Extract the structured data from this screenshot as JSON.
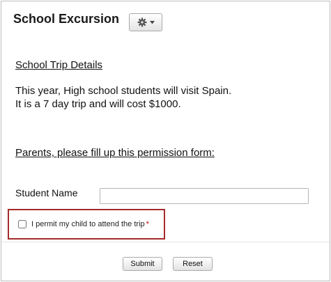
{
  "header": {
    "title": "School Excursion",
    "settings_icon": "gear-icon",
    "dropdown_icon": "caret-down-icon"
  },
  "details": {
    "heading": "School Trip Details",
    "line1": "This year, High school students will visit Spain.",
    "line2": "It is a 7 day trip and will cost $1000."
  },
  "form": {
    "heading": "Parents, please fill up this permission form:",
    "student_name_label": "Student Name",
    "student_name_value": "",
    "permission_label": "I permit my child to attend the trip",
    "required_mark": "*",
    "permission_checked": false,
    "highlight_color": "#a52a2a"
  },
  "actions": {
    "submit_label": "Submit",
    "reset_label": "Reset"
  }
}
